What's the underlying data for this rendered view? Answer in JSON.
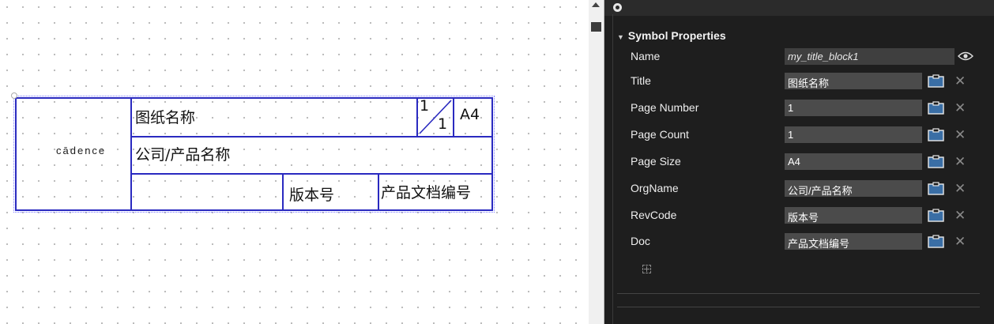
{
  "title_block": {
    "logo_text": "cādence",
    "title": "图纸名称",
    "page_number": "1",
    "page_count": "1",
    "page_size": "A4",
    "org_name": "公司/产品名称",
    "rev_code": "版本号",
    "doc": "产品文档编号"
  },
  "properties": {
    "section_title": "Symbol Properties",
    "name": {
      "label": "Name",
      "value": "my_title_block1"
    },
    "rows": [
      {
        "label": "Title",
        "value": "图纸名称"
      },
      {
        "label": "Page Number",
        "value": "1"
      },
      {
        "label": "Page Count",
        "value": "1"
      },
      {
        "label": "Page Size",
        "value": "A4"
      },
      {
        "label": "OrgName",
        "value": "公司/产品名称"
      },
      {
        "label": "RevCode",
        "value": "版本号"
      },
      {
        "label": "Doc",
        "value": "产品文档编号"
      }
    ],
    "close_glyph": "✕"
  },
  "colors": {
    "panel_bg": "#1e1e1e",
    "field_bg": "#4b4b4b",
    "title_block_stroke": "#2a2ac0",
    "icon_accent": "#3a6ea5"
  }
}
